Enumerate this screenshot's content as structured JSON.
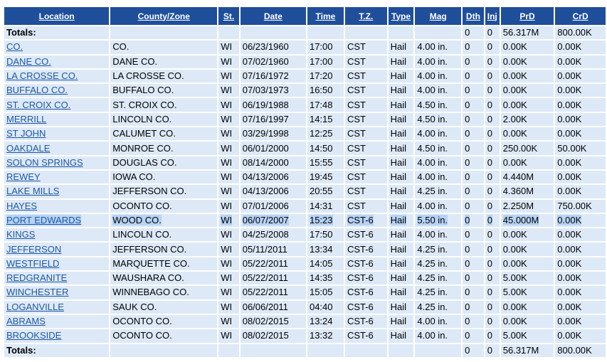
{
  "columns": [
    "Location",
    "County/Zone",
    "St.",
    "Date",
    "Time",
    "T.Z.",
    "Type",
    "Mag",
    "Dth",
    "Inj",
    "PrD",
    "CrD"
  ],
  "totals": {
    "label": "Totals:",
    "dth": "0",
    "inj": "0",
    "prd": "56.317M",
    "crd": "800.00K"
  },
  "selected_row_index": 12,
  "rows": [
    {
      "location": "CO.",
      "county": "CO.",
      "st": "WI",
      "date": "06/23/1960",
      "time": "17:00",
      "tz": "CST",
      "type": "Hail",
      "mag": "4.00 in.",
      "dth": "0",
      "inj": "0",
      "prd": "0.00K",
      "crd": "0.00K"
    },
    {
      "location": "DANE CO.",
      "county": "DANE CO.",
      "st": "WI",
      "date": "07/02/1960",
      "time": "17:00",
      "tz": "CST",
      "type": "Hail",
      "mag": "4.00 in.",
      "dth": "0",
      "inj": "0",
      "prd": "0.00K",
      "crd": "0.00K"
    },
    {
      "location": "LA CROSSE CO.",
      "county": "LA CROSSE CO.",
      "st": "WI",
      "date": "07/16/1972",
      "time": "17:20",
      "tz": "CST",
      "type": "Hail",
      "mag": "4.00 in.",
      "dth": "0",
      "inj": "0",
      "prd": "0.00K",
      "crd": "0.00K"
    },
    {
      "location": "BUFFALO CO.",
      "county": "BUFFALO CO.",
      "st": "WI",
      "date": "07/03/1973",
      "time": "16:50",
      "tz": "CST",
      "type": "Hail",
      "mag": "4.00 in.",
      "dth": "0",
      "inj": "0",
      "prd": "0.00K",
      "crd": "0.00K"
    },
    {
      "location": "ST. CROIX CO.",
      "county": "ST. CROIX CO.",
      "st": "WI",
      "date": "06/19/1988",
      "time": "17:48",
      "tz": "CST",
      "type": "Hail",
      "mag": "4.50 in.",
      "dth": "0",
      "inj": "0",
      "prd": "0.00K",
      "crd": "0.00K"
    },
    {
      "location": "MERRILL",
      "county": "LINCOLN CO.",
      "st": "WI",
      "date": "07/16/1997",
      "time": "14:15",
      "tz": "CST",
      "type": "Hail",
      "mag": "4.50 in.",
      "dth": "0",
      "inj": "0",
      "prd": "2.00K",
      "crd": "0.00K"
    },
    {
      "location": "ST JOHN",
      "county": "CALUMET CO.",
      "st": "WI",
      "date": "03/29/1998",
      "time": "12:25",
      "tz": "CST",
      "type": "Hail",
      "mag": "4.00 in.",
      "dth": "0",
      "inj": "0",
      "prd": "0.00K",
      "crd": "0.00K"
    },
    {
      "location": "OAKDALE",
      "county": "MONROE CO.",
      "st": "WI",
      "date": "06/01/2000",
      "time": "14:50",
      "tz": "CST",
      "type": "Hail",
      "mag": "4.50 in.",
      "dth": "0",
      "inj": "0",
      "prd": "250.00K",
      "crd": "50.00K"
    },
    {
      "location": "SOLON SPRINGS",
      "county": "DOUGLAS CO.",
      "st": "WI",
      "date": "08/14/2000",
      "time": "15:55",
      "tz": "CST",
      "type": "Hail",
      "mag": "4.00 in.",
      "dth": "0",
      "inj": "0",
      "prd": "0.00K",
      "crd": "0.00K"
    },
    {
      "location": "REWEY",
      "county": "IOWA CO.",
      "st": "WI",
      "date": "04/13/2006",
      "time": "19:45",
      "tz": "CST",
      "type": "Hail",
      "mag": "4.00 in.",
      "dth": "0",
      "inj": "0",
      "prd": "4.440M",
      "crd": "0.00K"
    },
    {
      "location": "LAKE MILLS",
      "county": "JEFFERSON CO.",
      "st": "WI",
      "date": "04/13/2006",
      "time": "20:55",
      "tz": "CST",
      "type": "Hail",
      "mag": "4.25 in.",
      "dth": "0",
      "inj": "0",
      "prd": "4.360M",
      "crd": "0.00K"
    },
    {
      "location": "HAYES",
      "county": "OCONTO CO.",
      "st": "WI",
      "date": "07/01/2006",
      "time": "14:31",
      "tz": "CST",
      "type": "Hail",
      "mag": "4.00 in.",
      "dth": "0",
      "inj": "0",
      "prd": "2.250M",
      "crd": "750.00K"
    },
    {
      "location": "PORT EDWARDS",
      "county": "WOOD CO.",
      "st": "WI",
      "date": "06/07/2007",
      "time": "15:23",
      "tz": "CST-6",
      "type": "Hail",
      "mag": "5.50 in.",
      "dth": "0",
      "inj": "0",
      "prd": "45.000M",
      "crd": "0.00K"
    },
    {
      "location": "KINGS",
      "county": "LINCOLN CO.",
      "st": "WI",
      "date": "04/25/2008",
      "time": "17:50",
      "tz": "CST-6",
      "type": "Hail",
      "mag": "4.00 in.",
      "dth": "0",
      "inj": "0",
      "prd": "0.00K",
      "crd": "0.00K"
    },
    {
      "location": "JEFFERSON",
      "county": "JEFFERSON CO.",
      "st": "WI",
      "date": "05/11/2011",
      "time": "13:34",
      "tz": "CST-6",
      "type": "Hail",
      "mag": "4.25 in.",
      "dth": "0",
      "inj": "0",
      "prd": "0.00K",
      "crd": "0.00K"
    },
    {
      "location": "WESTFIELD",
      "county": "MARQUETTE CO.",
      "st": "WI",
      "date": "05/22/2011",
      "time": "14:05",
      "tz": "CST-6",
      "type": "Hail",
      "mag": "4.25 in.",
      "dth": "0",
      "inj": "0",
      "prd": "0.00K",
      "crd": "0.00K"
    },
    {
      "location": "REDGRANITE",
      "county": "WAUSHARA CO.",
      "st": "WI",
      "date": "05/22/2011",
      "time": "14:35",
      "tz": "CST-6",
      "type": "Hail",
      "mag": "4.25 in.",
      "dth": "0",
      "inj": "0",
      "prd": "5.00K",
      "crd": "0.00K"
    },
    {
      "location": "WINCHESTER",
      "county": "WINNEBAGO CO.",
      "st": "WI",
      "date": "05/22/2011",
      "time": "15:05",
      "tz": "CST-6",
      "type": "Hail",
      "mag": "4.25 in.",
      "dth": "0",
      "inj": "0",
      "prd": "5.00K",
      "crd": "0.00K"
    },
    {
      "location": "LOGANVILLE",
      "county": "SAUK CO.",
      "st": "WI",
      "date": "06/06/2011",
      "time": "04:40",
      "tz": "CST-6",
      "type": "Hail",
      "mag": "4.25 in.",
      "dth": "0",
      "inj": "0",
      "prd": "0.00K",
      "crd": "0.00K"
    },
    {
      "location": "ABRAMS",
      "county": "OCONTO CO.",
      "st": "WI",
      "date": "08/02/2015",
      "time": "13:24",
      "tz": "CST-6",
      "type": "Hail",
      "mag": "4.00 in.",
      "dth": "0",
      "inj": "0",
      "prd": "0.00K",
      "crd": "0.00K"
    },
    {
      "location": "BROOKSIDE",
      "county": "OCONTO CO.",
      "st": "WI",
      "date": "08/02/2015",
      "time": "13:32",
      "tz": "CST-6",
      "type": "Hail",
      "mag": "4.00 in.",
      "dth": "0",
      "inj": "0",
      "prd": "5.00K",
      "crd": "0.00K"
    }
  ]
}
